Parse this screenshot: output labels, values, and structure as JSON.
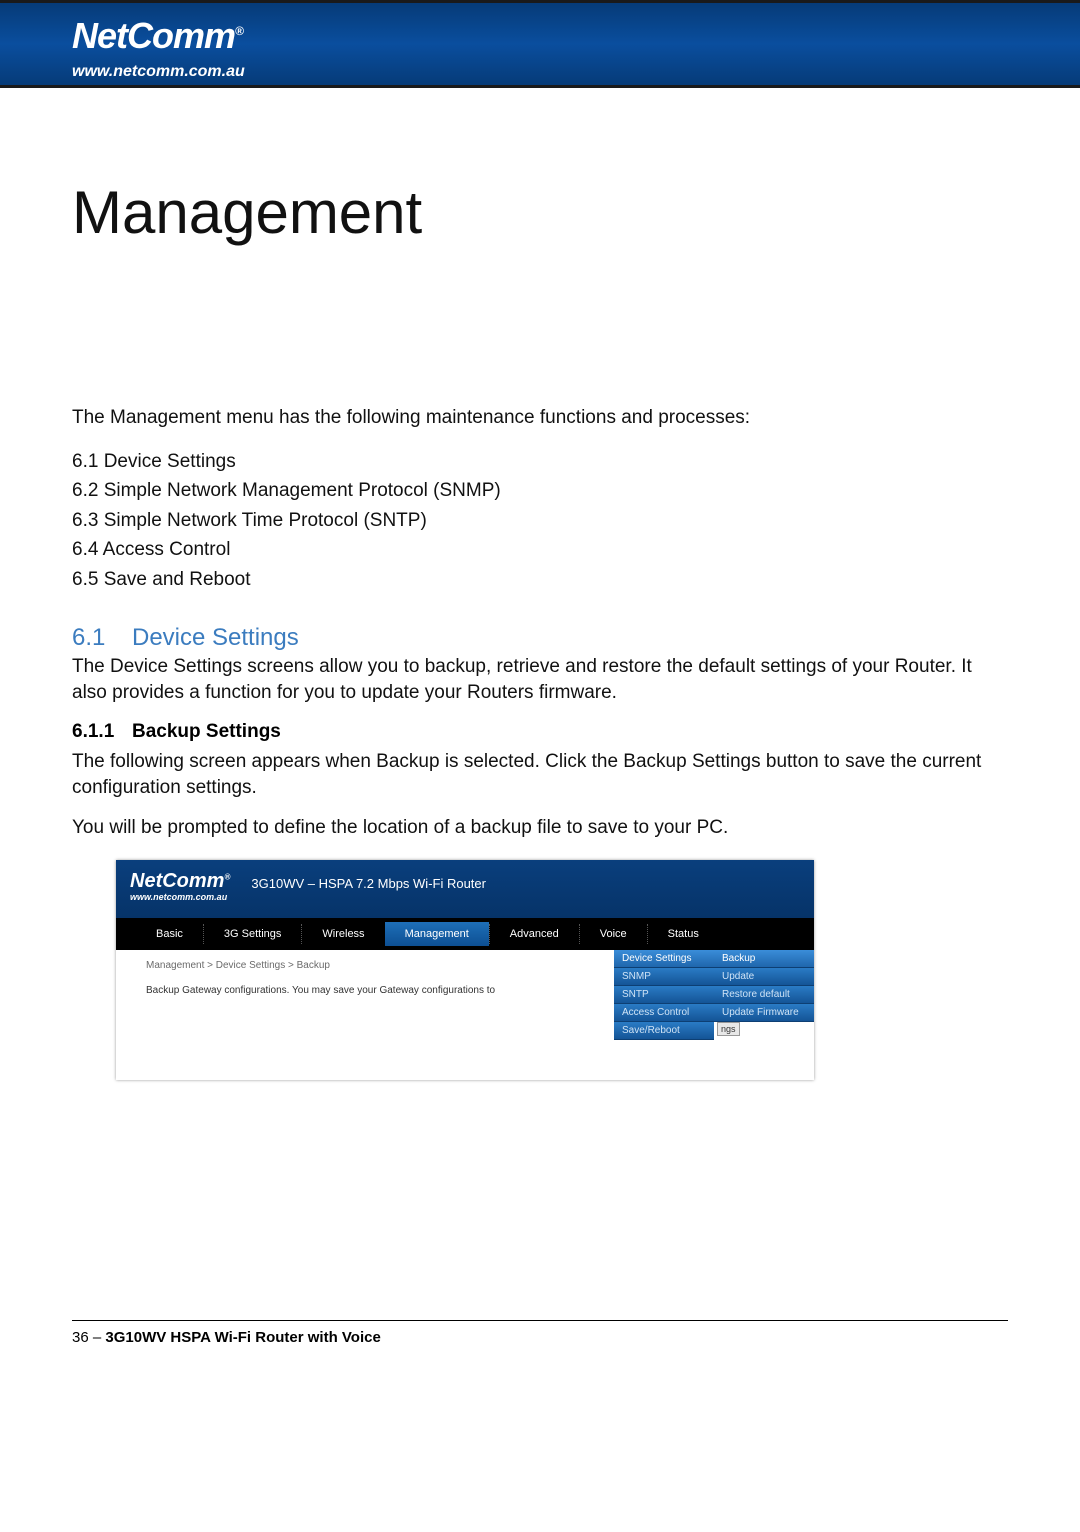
{
  "header": {
    "brand": "NetComm",
    "reg": "®",
    "url": "www.netcomm.com.au"
  },
  "page": {
    "title": "Management",
    "intro": "The Management menu has the following maintenance functions and processes:",
    "toc": [
      "6.1 Device Settings",
      "6.2 Simple Network Management Protocol (SNMP)",
      "6.3 Simple Network Time Protocol (SNTP)",
      "6.4  Access Control",
      "6.5 Save and Reboot"
    ],
    "s61": {
      "num": "6.1",
      "heading": "Device Settings",
      "text": "The Device Settings screens allow you to backup, retrieve and restore the default settings of your Router. It also provides a function for you to update your Routers firmware."
    },
    "s611": {
      "num": "6.1.1",
      "heading": "Backup Settings",
      "p1": "The following screen appears when Backup is selected. Click the Backup Settings button to save the current configuration settings.",
      "p2": "You will be prompted to define the location of a backup file to save to your PC."
    }
  },
  "router": {
    "brand": "NetComm",
    "reg": "®",
    "url": "www.netcomm.com.au",
    "model": "3G10WV – HSPA 7.2 Mbps Wi-Fi Router",
    "tabs": [
      "Basic",
      "3G Settings",
      "Wireless",
      "Management",
      "Advanced",
      "Voice",
      "Status"
    ],
    "breadcrumb": "Management > Device Settings > Backup",
    "desc": "Backup Gateway configurations. You may save your Gateway configurations to",
    "menu1": [
      "Device Settings",
      "SNMP",
      "SNTP",
      "Access Control",
      "Save/Reboot"
    ],
    "menu2": [
      "Backup",
      "Update",
      "Restore default",
      "Update Firmware"
    ],
    "btn": "ngs"
  },
  "footer": {
    "page": "36 – ",
    "doc": "3G10WV HSPA Wi-Fi Router with Voice"
  }
}
